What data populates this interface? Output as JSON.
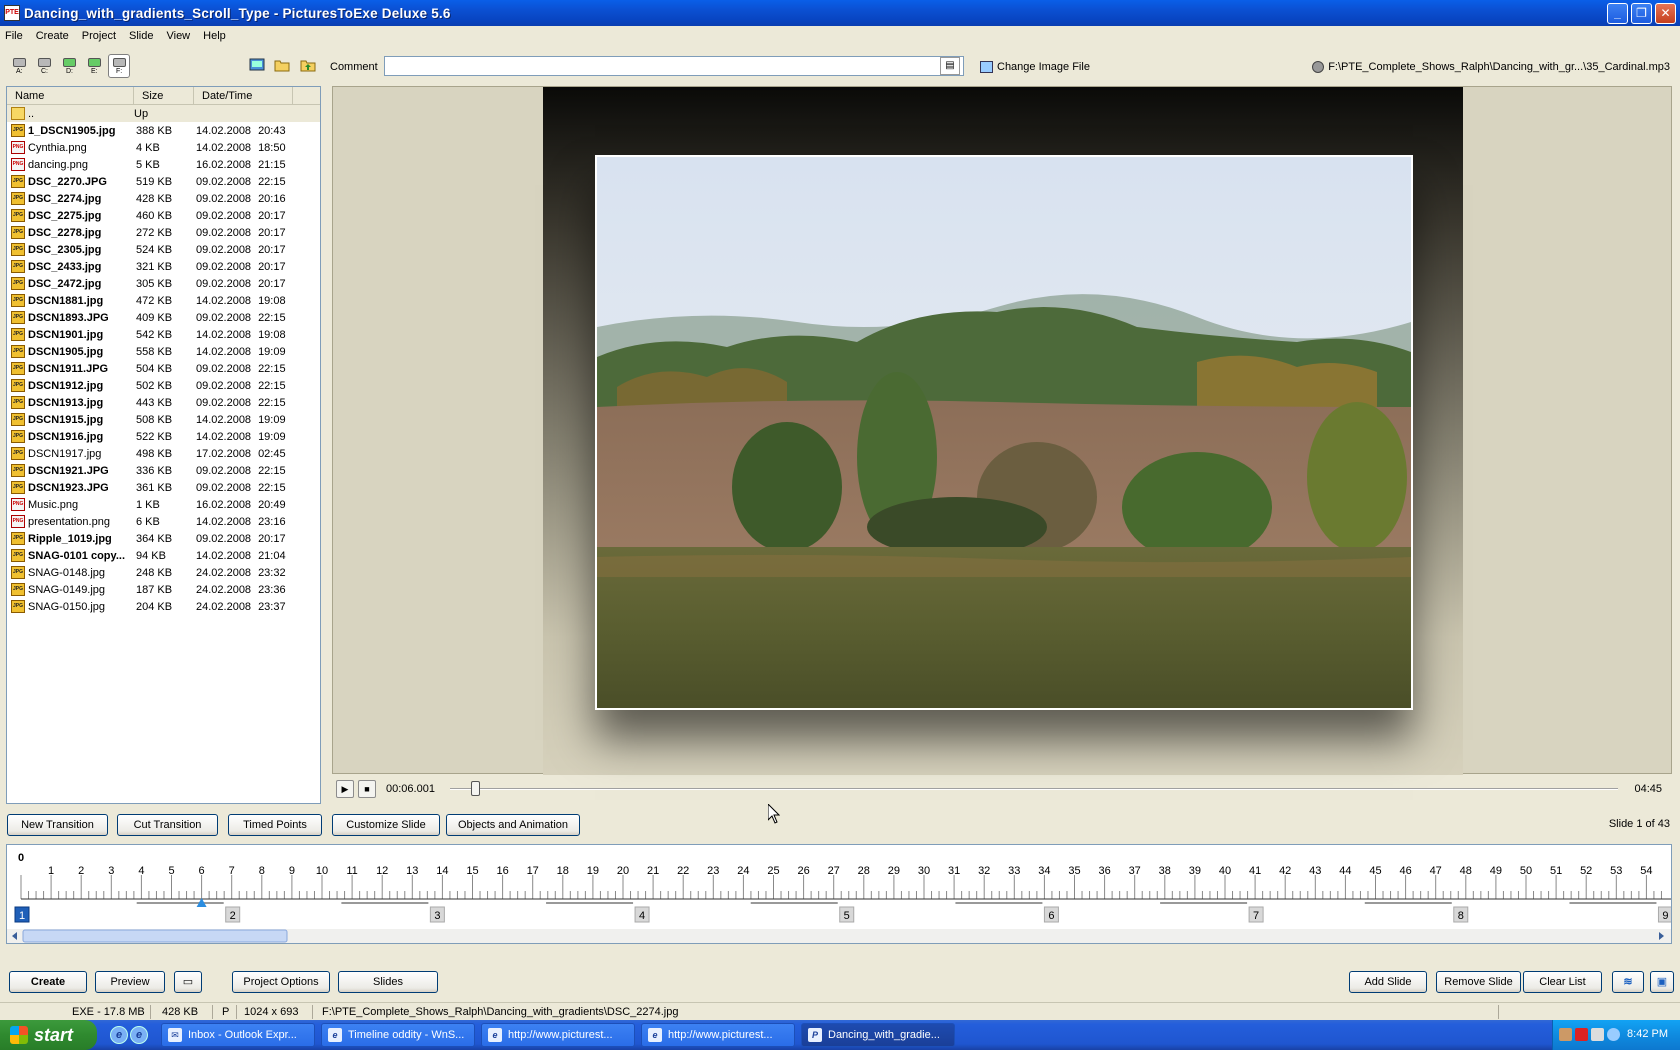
{
  "window": {
    "title": "Dancing_with_gradients_Scroll_Type - PicturesToExe Deluxe 5.6",
    "app_icon": "PTE",
    "minimize_icon": "minimize-icon",
    "maximize_icon": "maximize-icon",
    "close_icon": "close-icon"
  },
  "menu": [
    {
      "label": "File"
    },
    {
      "label": "Create"
    },
    {
      "label": "Project"
    },
    {
      "label": "Slide"
    },
    {
      "label": "View"
    },
    {
      "label": "Help"
    }
  ],
  "toolbar": {
    "drives": [
      {
        "letter": "A:"
      },
      {
        "letter": "C:"
      },
      {
        "letter": "D:"
      },
      {
        "letter": "E:"
      },
      {
        "letter": "F:"
      }
    ],
    "active_drive_index": 4,
    "comment_label": "Comment",
    "comment_value": "",
    "change_image_label": "Change Image File",
    "music_path": "F:\\PTE_Complete_Shows_Ralph\\Dancing_with_gr...\\35_Cardinal.mp3"
  },
  "file_browser": {
    "columns": [
      "Name",
      "Size",
      "Date/Time"
    ],
    "up_row": {
      "name": "..",
      "size": "Up"
    },
    "files": [
      {
        "name": "1_DSCN1905.jpg",
        "size": "388 KB",
        "date": "14.02.2008",
        "time": "20:43",
        "type": "JPG",
        "bold": true
      },
      {
        "name": "Cynthia.png",
        "size": "4 KB",
        "date": "14.02.2008",
        "time": "18:50",
        "type": "PNG",
        "bold": false
      },
      {
        "name": "dancing.png",
        "size": "5 KB",
        "date": "16.02.2008",
        "time": "21:15",
        "type": "PNG",
        "bold": false
      },
      {
        "name": "DSC_2270.JPG",
        "size": "519 KB",
        "date": "09.02.2008",
        "time": "22:15",
        "type": "JPG",
        "bold": true
      },
      {
        "name": "DSC_2274.jpg",
        "size": "428 KB",
        "date": "09.02.2008",
        "time": "20:16",
        "type": "JPG",
        "bold": true
      },
      {
        "name": "DSC_2275.jpg",
        "size": "460 KB",
        "date": "09.02.2008",
        "time": "20:17",
        "type": "JPG",
        "bold": true
      },
      {
        "name": "DSC_2278.jpg",
        "size": "272 KB",
        "date": "09.02.2008",
        "time": "20:17",
        "type": "JPG",
        "bold": true
      },
      {
        "name": "DSC_2305.jpg",
        "size": "524 KB",
        "date": "09.02.2008",
        "time": "20:17",
        "type": "JPG",
        "bold": true
      },
      {
        "name": "DSC_2433.jpg",
        "size": "321 KB",
        "date": "09.02.2008",
        "time": "20:17",
        "type": "JPG",
        "bold": true
      },
      {
        "name": "DSC_2472.jpg",
        "size": "305 KB",
        "date": "09.02.2008",
        "time": "20:17",
        "type": "JPG",
        "bold": true
      },
      {
        "name": "DSCN1881.jpg",
        "size": "472 KB",
        "date": "14.02.2008",
        "time": "19:08",
        "type": "JPG",
        "bold": true
      },
      {
        "name": "DSCN1893.JPG",
        "size": "409 KB",
        "date": "09.02.2008",
        "time": "22:15",
        "type": "JPG",
        "bold": true
      },
      {
        "name": "DSCN1901.jpg",
        "size": "542 KB",
        "date": "14.02.2008",
        "time": "19:08",
        "type": "JPG",
        "bold": true
      },
      {
        "name": "DSCN1905.jpg",
        "size": "558 KB",
        "date": "14.02.2008",
        "time": "19:09",
        "type": "JPG",
        "bold": true
      },
      {
        "name": "DSCN1911.JPG",
        "size": "504 KB",
        "date": "09.02.2008",
        "time": "22:15",
        "type": "JPG",
        "bold": true
      },
      {
        "name": "DSCN1912.jpg",
        "size": "502 KB",
        "date": "09.02.2008",
        "time": "22:15",
        "type": "JPG",
        "bold": true
      },
      {
        "name": "DSCN1913.jpg",
        "size": "443 KB",
        "date": "09.02.2008",
        "time": "22:15",
        "type": "JPG",
        "bold": true
      },
      {
        "name": "DSCN1915.jpg",
        "size": "508 KB",
        "date": "14.02.2008",
        "time": "19:09",
        "type": "JPG",
        "bold": true
      },
      {
        "name": "DSCN1916.jpg",
        "size": "522 KB",
        "date": "14.02.2008",
        "time": "19:09",
        "type": "JPG",
        "bold": true
      },
      {
        "name": "DSCN1917.jpg",
        "size": "498 KB",
        "date": "17.02.2008",
        "time": "02:45",
        "type": "JPG",
        "bold": false
      },
      {
        "name": "DSCN1921.JPG",
        "size": "336 KB",
        "date": "09.02.2008",
        "time": "22:15",
        "type": "JPG",
        "bold": true
      },
      {
        "name": "DSCN1923.JPG",
        "size": "361 KB",
        "date": "09.02.2008",
        "time": "22:15",
        "type": "JPG",
        "bold": true
      },
      {
        "name": "Music.png",
        "size": "1 KB",
        "date": "16.02.2008",
        "time": "20:49",
        "type": "PNG",
        "bold": false
      },
      {
        "name": "presentation.png",
        "size": "6 KB",
        "date": "14.02.2008",
        "time": "23:16",
        "type": "PNG",
        "bold": false
      },
      {
        "name": "Ripple_1019.jpg",
        "size": "364 KB",
        "date": "09.02.2008",
        "time": "20:17",
        "type": "JPG",
        "bold": true
      },
      {
        "name": "SNAG-0101 copy...",
        "size": "94 KB",
        "date": "14.02.2008",
        "time": "21:04",
        "type": "JPG",
        "bold": true
      },
      {
        "name": "SNAG-0148.jpg",
        "size": "248 KB",
        "date": "24.02.2008",
        "time": "23:32",
        "type": "JPG",
        "bold": false
      },
      {
        "name": "SNAG-0149.jpg",
        "size": "187 KB",
        "date": "24.02.2008",
        "time": "23:36",
        "type": "JPG",
        "bold": false
      },
      {
        "name": "SNAG-0150.jpg",
        "size": "204 KB",
        "date": "24.02.2008",
        "time": "23:37",
        "type": "JPG",
        "bold": false
      }
    ]
  },
  "playback": {
    "play_icon": "play-icon",
    "stop_icon": "stop-icon",
    "current_time": "00:06.001",
    "total_time": "04:45",
    "position_fraction": 0.021
  },
  "slide_buttons": {
    "new_transition": "New Transition",
    "cut_transition": "Cut Transition",
    "timed_points": "Timed Points",
    "customize_slide": "Customize Slide",
    "objects_animation": "Objects and Animation",
    "slide_count": "Slide 1 of 43"
  },
  "timeline": {
    "start_label": "0",
    "seconds_visible": 55,
    "slide_markers": [
      {
        "label": "1",
        "second": 0,
        "selected": true
      },
      {
        "label": "2",
        "second": 7
      },
      {
        "label": "3",
        "second": 13.8
      },
      {
        "label": "4",
        "second": 20.6
      },
      {
        "label": "5",
        "second": 27.4
      },
      {
        "label": "6",
        "second": 34.2
      },
      {
        "label": "7",
        "second": 41
      },
      {
        "label": "8",
        "second": 47.8
      },
      {
        "label": "9",
        "second": 54.6
      }
    ],
    "playhead_second": 6
  },
  "bottom_buttons": {
    "create": "Create",
    "preview": "Preview",
    "project_options": "Project Options",
    "slides": "Slides",
    "add_slide": "Add Slide",
    "remove_slide": "Remove Slide",
    "clear_list": "Clear List"
  },
  "statusbar": {
    "exe_size": "EXE - 17.8 MB",
    "file_size": "428 KB",
    "orientation": "P",
    "dimensions": "1024 x 693",
    "file_path": "F:\\PTE_Complete_Shows_Ralph\\Dancing_with_gradients\\DSC_2274.jpg"
  },
  "taskbar": {
    "start_label": "start",
    "tasks": [
      {
        "label": "Inbox - Outlook Expr..."
      },
      {
        "label": "Timeline oddity - WnS..."
      },
      {
        "label": "http://www.picturest..."
      },
      {
        "label": "http://www.picturest..."
      },
      {
        "label": "Dancing_with_gradie..."
      }
    ],
    "active_task_index": 4,
    "clock": "8:42 PM"
  },
  "colors": {
    "titlebar": "#0a4fd1",
    "marker_selected": "#1f5fb8",
    "playhead": "#2b8de0"
  }
}
